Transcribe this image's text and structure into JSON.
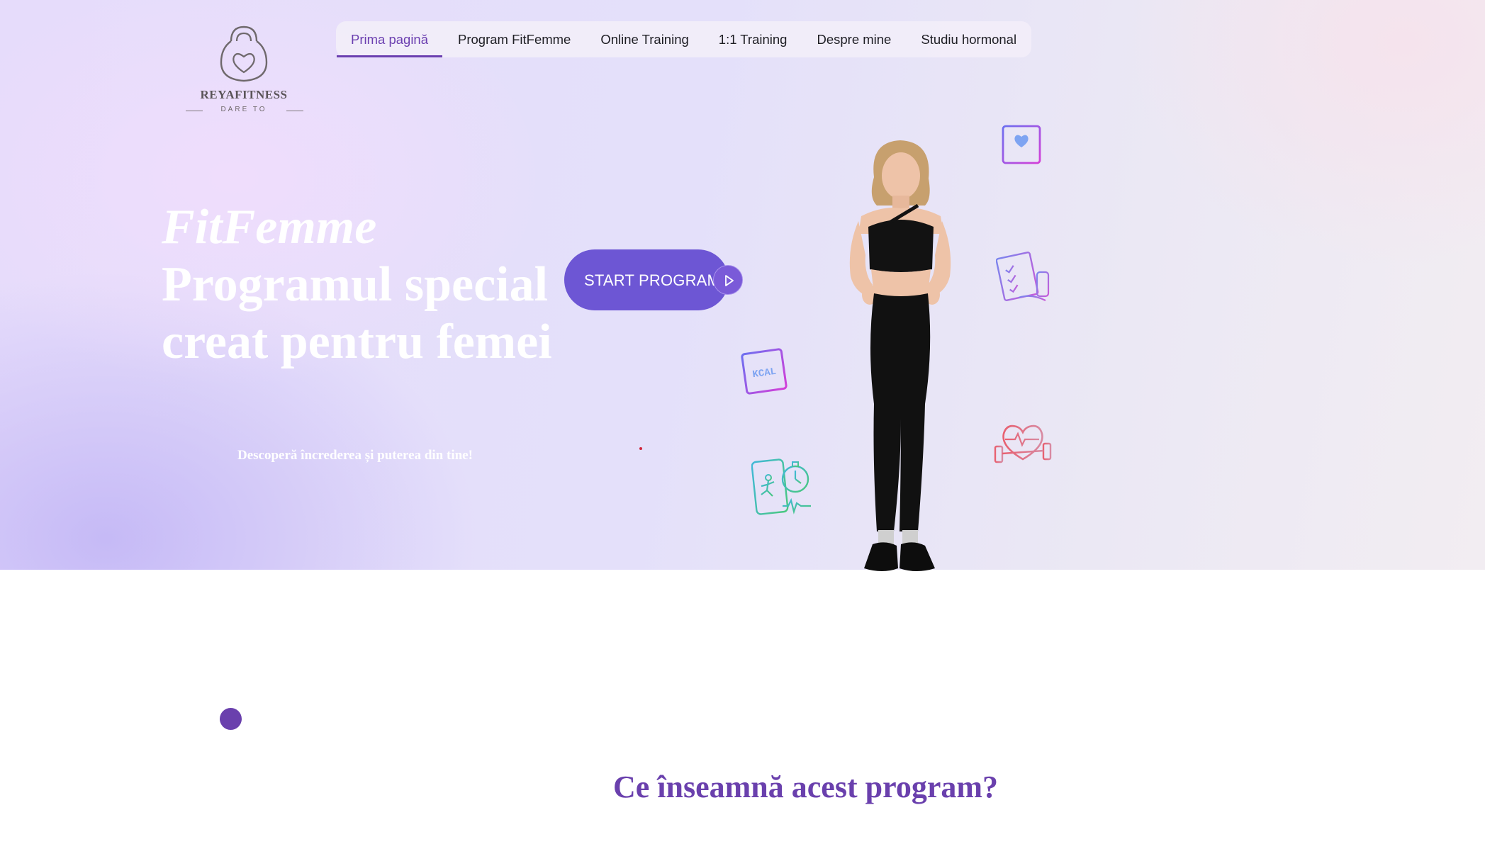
{
  "logo": {
    "name": "REYAFITNESS",
    "tagline": "DARE TO"
  },
  "nav": {
    "items": [
      {
        "label": "Prima pagină",
        "active": true
      },
      {
        "label": "Program FitFemme",
        "active": false
      },
      {
        "label": "Online Training",
        "active": false
      },
      {
        "label": "1:1 Training",
        "active": false
      },
      {
        "label": "Despre mine",
        "active": false
      },
      {
        "label": "Studiu hormonal",
        "active": false
      }
    ]
  },
  "hero": {
    "title_italic": "FitFemme",
    "title_rest": "Programul special creat pentru femei",
    "tagline": "Descoperă încrederea și puterea din tine!",
    "cta_label": "START PROGRAM",
    "icons": [
      "heart-card-icon",
      "clipboard-checklist-icon",
      "kcal-card-icon",
      "heart-dumbbell-icon",
      "phone-running-stopwatch-icon"
    ]
  },
  "section": {
    "title": "Ce înseamnă acest program?"
  },
  "colors": {
    "accent": "#6a40ad",
    "button": "#6d56d4",
    "nav_text": "#1e1e24"
  }
}
